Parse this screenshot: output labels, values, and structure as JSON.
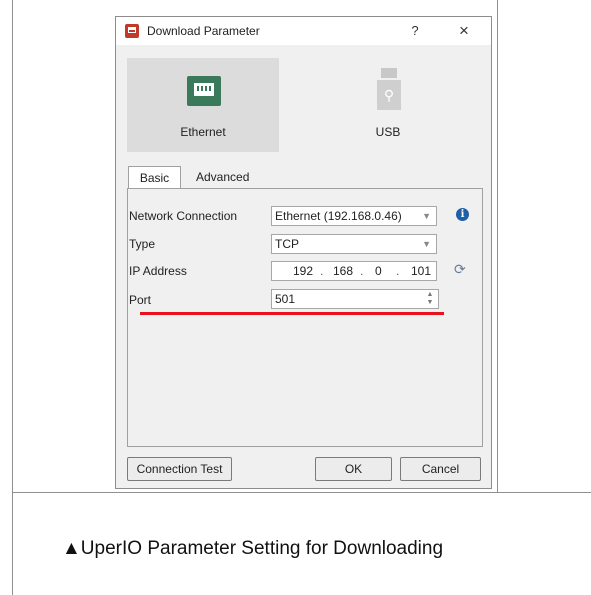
{
  "dialog": {
    "title": "Download Parameter",
    "help_label": "?",
    "close_label": "×",
    "connection_types": [
      {
        "label": "Ethernet",
        "selected": true
      },
      {
        "label": "USB",
        "selected": false
      }
    ],
    "tabs": [
      {
        "label": "Basic",
        "active": true
      },
      {
        "label": "Advanced",
        "active": false
      }
    ],
    "fields": {
      "network_connection": {
        "label": "Network Connection",
        "value": "Ethernet (192.168.0.46)"
      },
      "type": {
        "label": "Type",
        "value": "TCP"
      },
      "ip_address": {
        "label": "IP Address",
        "octets": [
          "192",
          "168",
          "0",
          "101"
        ],
        "separator": "."
      },
      "port": {
        "label": "Port",
        "value": "501"
      }
    },
    "buttons": {
      "connection_test": "Connection Test",
      "ok": "OK",
      "cancel": "Cancel"
    }
  },
  "icons": {
    "info": "info-icon",
    "refresh": "refresh-icon",
    "ethernet": "ethernet-port-icon",
    "usb": "usb-drive-icon"
  },
  "colors": {
    "highlight_underline": "#e8111c",
    "ethernet_icon": "#3a7a5a",
    "info_icon": "#1f5fa8"
  },
  "caption": "▲UperIO Parameter Setting for Downloading"
}
